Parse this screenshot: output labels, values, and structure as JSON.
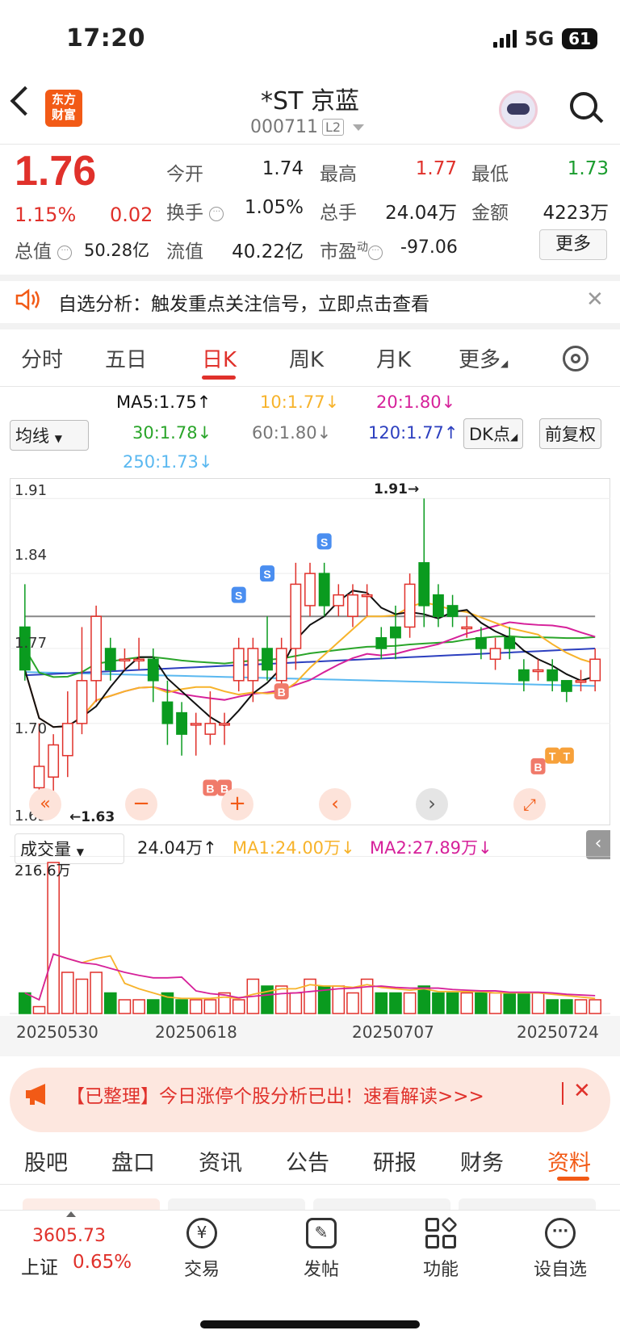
{
  "status": {
    "time": "17:20",
    "network": "5G",
    "battery": "61"
  },
  "header": {
    "name": "*ST 京蓝",
    "code": "000711",
    "level": "L2",
    "logo_line1": "东方",
    "logo_line2": "财富"
  },
  "quote": {
    "price": "1.76",
    "change_pct": "1.15%",
    "change_abs": "0.02",
    "rows": [
      [
        {
          "label": "今开",
          "value": "1.74",
          "color": "#222"
        },
        {
          "label": "最高",
          "value": "1.77",
          "color": "#e0312b"
        },
        {
          "label": "最低",
          "value": "1.73",
          "color": "#1a9c2e"
        }
      ],
      [
        {
          "label": "换手",
          "value": "1.05%",
          "color": "#222"
        },
        {
          "label": "总手",
          "value": "24.04万",
          "color": "#222"
        },
        {
          "label": "金额",
          "value": "4223万",
          "color": "#222"
        }
      ]
    ],
    "total_value_label": "总值",
    "total_value": "50.28亿",
    "float_value_label": "流值",
    "float_value": "40.22亿",
    "pe_label": "市盈",
    "pe_sup": "动",
    "pe_value": "-97.06",
    "more": "更多"
  },
  "notice": {
    "text": "自选分析：触发重点关注信号，立即点击查看"
  },
  "chart_tabs": [
    "分时",
    "五日",
    "日K",
    "周K",
    "月K",
    "更多"
  ],
  "ma_legend": {
    "selector": "均线",
    "ma5": "MA5:1.75",
    "ma10": "10:1.77",
    "ma20": "20:1.80",
    "ma30": "30:1.78",
    "ma60": "60:1.80",
    "ma120": "120:1.77",
    "ma250": "250:1.73",
    "dk": "DK点",
    "fq": "前复权"
  },
  "colors": {
    "up": "#e0312b",
    "down": "#0a9b1f",
    "ma5": "#111111",
    "ma10": "#f7b32b",
    "ma20": "#d6219a",
    "ma30": "#2aa52a",
    "ma60": "#888888",
    "ma120": "#2c3fbf",
    "ma250": "#5ab8f0"
  },
  "kline": {
    "y_ticks": [
      "1.91",
      "1.84",
      "1.77",
      "1.70",
      "1.63"
    ],
    "ymin": 1.62,
    "ymax": 1.92,
    "max_label": "1.91→",
    "min_label": "←1.63",
    "candles": [
      [
        1.79,
        1.75,
        1.74,
        1.83
      ],
      [
        1.64,
        1.66,
        1.63,
        1.7
      ],
      [
        1.65,
        1.68,
        1.63,
        1.69
      ],
      [
        1.67,
        1.7,
        1.65,
        1.73
      ],
      [
        1.7,
        1.74,
        1.69,
        1.79
      ],
      [
        1.74,
        1.8,
        1.72,
        1.81
      ],
      [
        1.77,
        1.75,
        1.74,
        1.78
      ],
      [
        1.76,
        1.76,
        1.75,
        1.77
      ],
      [
        1.76,
        1.76,
        1.75,
        1.78
      ],
      [
        1.76,
        1.74,
        1.72,
        1.77
      ],
      [
        1.72,
        1.7,
        1.68,
        1.74
      ],
      [
        1.71,
        1.69,
        1.67,
        1.72
      ],
      [
        1.7,
        1.7,
        1.67,
        1.71
      ],
      [
        1.69,
        1.7,
        1.68,
        1.73
      ],
      [
        1.7,
        1.7,
        1.68,
        1.71
      ],
      [
        1.74,
        1.77,
        1.73,
        1.78
      ],
      [
        1.74,
        1.77,
        1.72,
        1.78
      ],
      [
        1.77,
        1.75,
        1.74,
        1.8
      ],
      [
        1.74,
        1.77,
        1.73,
        1.78
      ],
      [
        1.77,
        1.83,
        1.75,
        1.85
      ],
      [
        1.81,
        1.84,
        1.8,
        1.85
      ],
      [
        1.84,
        1.81,
        1.8,
        1.85
      ],
      [
        1.81,
        1.82,
        1.8,
        1.83
      ],
      [
        1.8,
        1.82,
        1.79,
        1.83
      ],
      [
        1.82,
        1.82,
        1.8,
        1.83
      ],
      [
        1.78,
        1.77,
        1.76,
        1.79
      ],
      [
        1.79,
        1.78,
        1.76,
        1.81
      ],
      [
        1.79,
        1.83,
        1.78,
        1.84
      ],
      [
        1.85,
        1.81,
        1.79,
        1.91
      ],
      [
        1.82,
        1.8,
        1.79,
        1.83
      ],
      [
        1.81,
        1.8,
        1.79,
        1.82
      ],
      [
        1.79,
        1.79,
        1.78,
        1.8
      ],
      [
        1.78,
        1.77,
        1.76,
        1.79
      ],
      [
        1.76,
        1.77,
        1.75,
        1.78
      ],
      [
        1.78,
        1.77,
        1.76,
        1.79
      ],
      [
        1.75,
        1.74,
        1.73,
        1.76
      ],
      [
        1.75,
        1.75,
        1.74,
        1.76
      ],
      [
        1.75,
        1.74,
        1.73,
        1.76
      ],
      [
        1.74,
        1.73,
        1.72,
        1.74
      ],
      [
        1.74,
        1.74,
        1.73,
        1.75
      ],
      [
        1.74,
        1.76,
        1.73,
        1.77
      ]
    ]
  },
  "volume": {
    "selector": "成交量",
    "value": "24.04万",
    "ma1": "MA1:24.00万",
    "ma2": "MA2:27.89万",
    "y_label": "216.6万",
    "bars": [
      3,
      1,
      22,
      6,
      5,
      6,
      3,
      2,
      2,
      2,
      3,
      2,
      2,
      2,
      3,
      2,
      5,
      4,
      4,
      3,
      5,
      4,
      4,
      3,
      5,
      3,
      3,
      3,
      4,
      3,
      3,
      3,
      3,
      3,
      3,
      3,
      3,
      2,
      2,
      2,
      2
    ],
    "dates": [
      "20250530",
      "20250618",
      "20250707",
      "20250724"
    ]
  },
  "promo": {
    "text": "【已整理】今日涨停个股分析已出！速看解读>>>"
  },
  "bottom_tabs": [
    "股吧",
    "盘口",
    "资讯",
    "公告",
    "研报",
    "财务",
    "资料"
  ],
  "nav": {
    "index_value": "3605.73",
    "index_name": "上证",
    "index_pct": "0.65%",
    "items": [
      "交易",
      "发帖",
      "功能",
      "设自选"
    ]
  },
  "signals": {
    "sell": "S",
    "buy": "B",
    "t": "T"
  }
}
